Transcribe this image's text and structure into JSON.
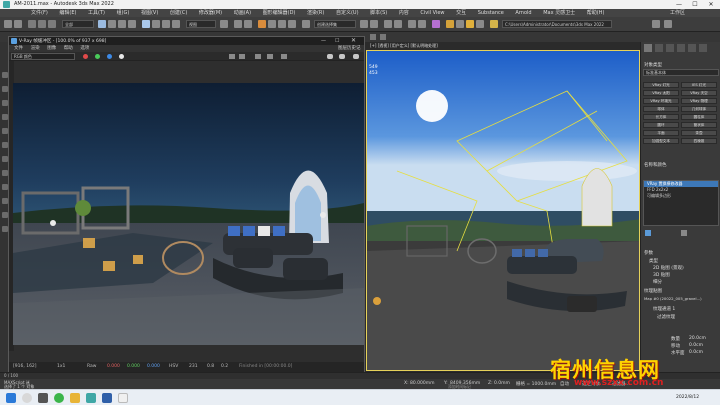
{
  "window": {
    "title": "AM-2011.max - Autodesk 3ds Max 2022",
    "minimize": "—",
    "maximize": "☐",
    "close": "✕"
  },
  "menu": [
    "文件(F)",
    "编辑(E)",
    "工具(T)",
    "组(G)",
    "视图(V)",
    "创建(C)",
    "修改器(M)",
    "动画(A)",
    "图形编辑器(D)",
    "渲染(R)",
    "自定义(U)",
    "脚本(S)",
    "内容",
    "Civil View",
    "交互",
    "Substance",
    "Arnold",
    "Max 灵感卫士",
    "帮助(H)",
    "工作区"
  ],
  "toolbar": {
    "filter_select": "全部",
    "view_select": "视图",
    "selection_set": "创建选择集",
    "path": "C:\\Users\\Administrator\\Documents\\3ds Max 2022"
  },
  "vfb": {
    "title": "V-Ray 帧缓冲区 - [100.0% of 937 x 698]",
    "history_label": "图层历史记录",
    "menu": [
      "文件",
      "渲染",
      "图像",
      "帮助",
      "选项"
    ],
    "channel_select": "RGB 颜色",
    "status": {
      "coords": "[916, 162]",
      "mode": "1x1",
      "filter": "Raw",
      "r": "0.000",
      "g": "0.000",
      "b": "0.000",
      "color_space": "HSV",
      "h": "231",
      "s": "0.8",
      "v": "0.2",
      "finished": "Finished in [00:00:00.0]"
    }
  },
  "viewport": {
    "label": "[+] [透视] [用户定义] [默认明暗处理]",
    "stats1": "549",
    "stats2": "453"
  },
  "command_panel": {
    "object_type_label": "对象类型",
    "category_select": "标准基本体",
    "buttons": [
      "VRay 灯光",
      "IES 灯光",
      "VRay 太阳",
      "VRay 天空",
      "VRay 环境光",
      "VRay 物理",
      "球体",
      "几何球体",
      "长方体",
      "圆柱体",
      "圆环",
      "管状体",
      "平面",
      "茶壶",
      "加强型文本",
      "四棱锥"
    ],
    "name_label": "名称和颜色",
    "stack": [
      "VRay 置换模修改器",
      "FFD 2x2x2",
      "可编辑多边形"
    ],
    "params_title": "参数",
    "params": [
      "类型",
      "2D 贴图 (景观)",
      "3D 贴图",
      "细分"
    ],
    "tex_label": "纹理贴图",
    "tex_value": "Map #0 (20022_005_gravel...)",
    "resolution_label": "纹理通道 1",
    "filter_label": "过滤纹理",
    "amount_label": "数量",
    "amount_value": "20.0cm",
    "shift_label": "移动",
    "shift_value": "0.0cm",
    "water_label": "水平面",
    "water_value": "0.0cm"
  },
  "timeline": {
    "frame": "0 / 100"
  },
  "status": {
    "selection": "选择了 1 个 对象",
    "script": "MAXScript 迷",
    "x_label": "X:",
    "x": "80.000mm",
    "y_label": "Y:",
    "y": "8409.356mm",
    "z_label": "Z:",
    "z": "0.0mm",
    "grid_label": "栅格 = 1000.0mm",
    "time_tag": "添加时间标记",
    "autokey": "自动",
    "selected": "选定对象",
    "keyfilter": "过滤器..."
  },
  "taskbar": {
    "time": "2022/8/12"
  },
  "watermark": {
    "text": "宿州信息网",
    "url": "www.szxx.com.cn"
  }
}
